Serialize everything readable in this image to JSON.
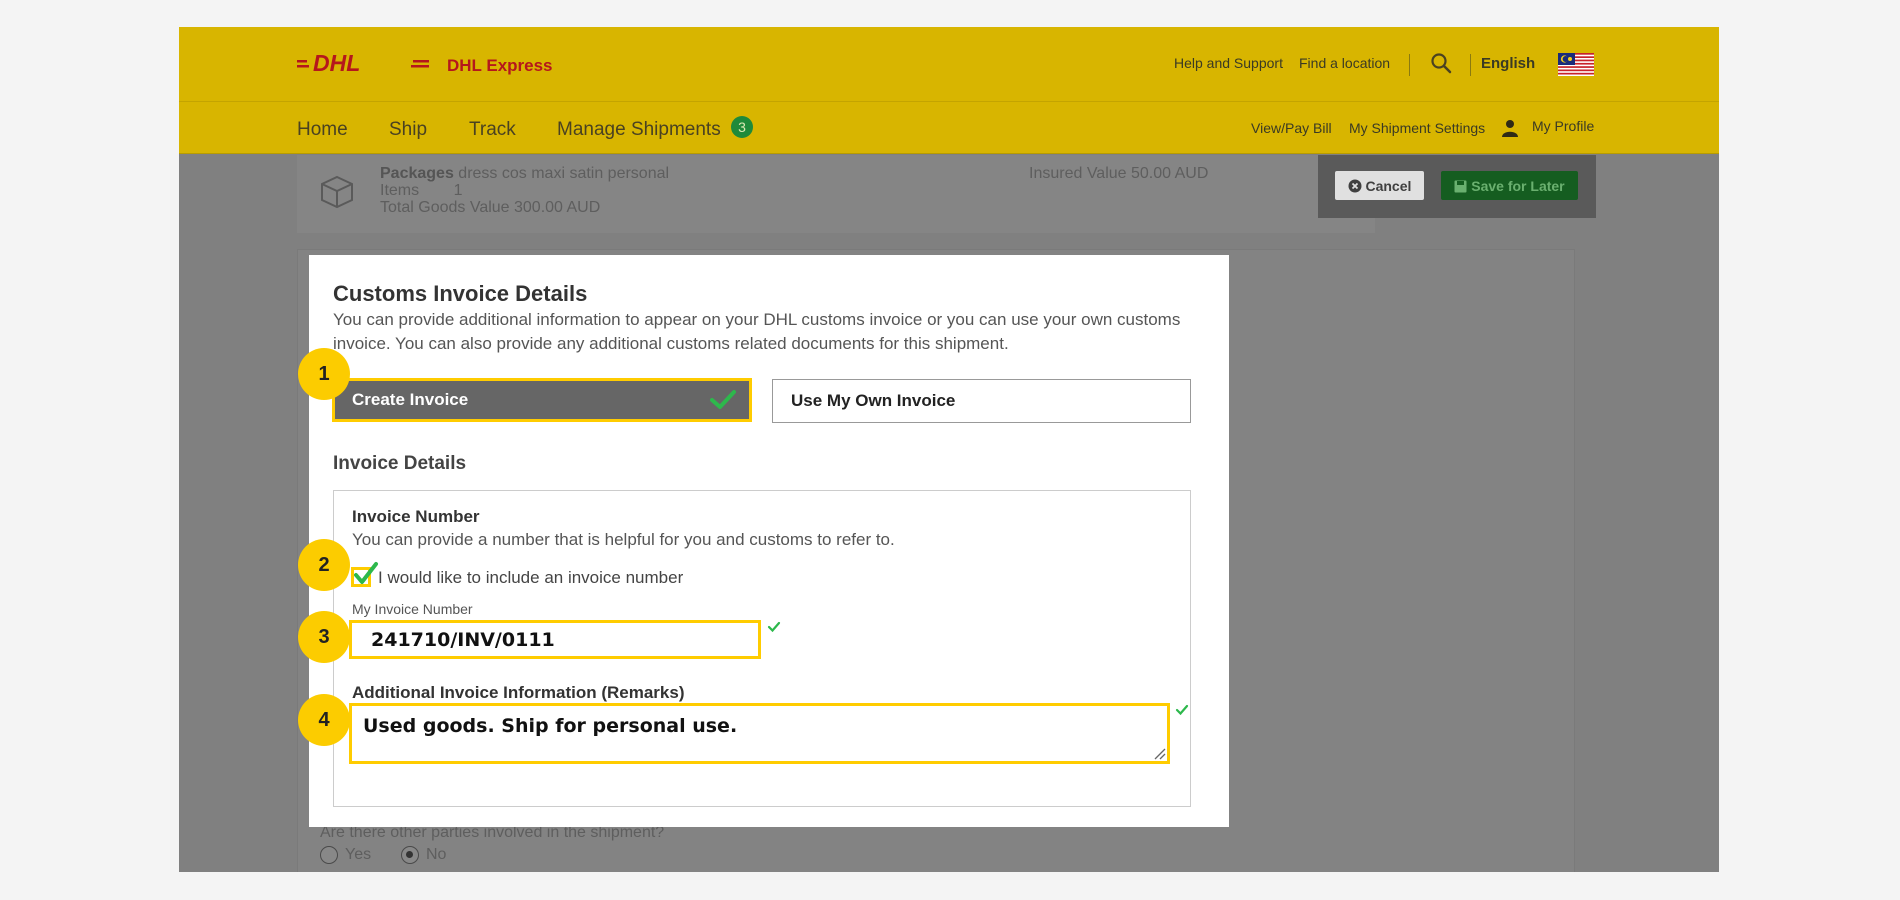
{
  "header": {
    "brand_name": "DHL Express",
    "help_link": "Help and Support",
    "locate_link": "Find a location",
    "language": "English",
    "logo_text": "DHL"
  },
  "nav": {
    "items": [
      "Home",
      "Ship",
      "Track",
      "Manage Shipments"
    ],
    "badge_count": "3",
    "view_pay_bill": "View/Pay Bill",
    "shipment_settings": "My Shipment Settings",
    "my_profile": "My Profile"
  },
  "summary": {
    "packages_label": "Packages",
    "packages_desc": "dress cos maxi satin personal",
    "items_label": "Items",
    "items_count": "1",
    "total_goods": "Total Goods Value 300.00 AUD",
    "insured_value": "Insured Value 50.00 AUD",
    "cancel_label": "Cancel",
    "save_label": "Save for Later"
  },
  "parties": {
    "question": "Are there other parties involved in the shipment?",
    "yes_label": "Yes",
    "no_label": "No",
    "selected": "No"
  },
  "modal": {
    "title": "Customs Invoice Details",
    "description": "You can provide additional information to appear on your DHL customs invoice or you can use your own customs invoice. You can also provide any additional customs related documents for this shipment.",
    "tab_create": "Create Invoice",
    "tab_own": "Use My Own Invoice",
    "section_title": "Invoice Details",
    "invoice_number_title": "Invoice Number",
    "invoice_number_hint": "You can provide a number that is helpful for you and customs to refer to.",
    "include_checkbox_label": "I would like to include an invoice number",
    "include_checked": true,
    "my_invoice_label": "My Invoice Number",
    "invoice_number_value": "241710/INV/0111",
    "remarks_label": "Additional Invoice Information (Remarks)",
    "remarks_value": "Used goods. Ship for personal use."
  },
  "steps": [
    "1",
    "2",
    "3",
    "4"
  ],
  "colors": {
    "dhl_yellow": "#ffcc00",
    "dhl_red": "#d40511",
    "success_green": "#2db84c",
    "step_yellow": "#fccc00"
  }
}
